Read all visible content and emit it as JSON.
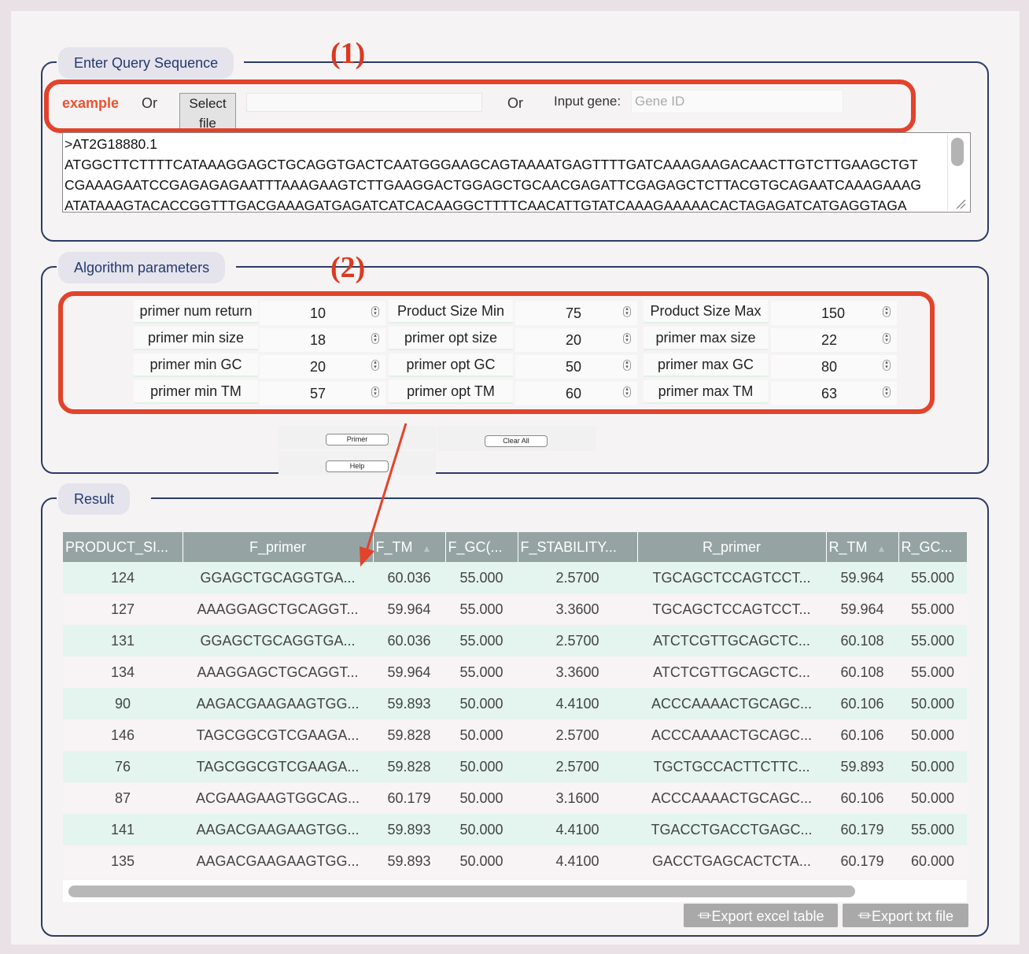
{
  "annotations": {
    "label1": "(1)",
    "label2": "(2)"
  },
  "query": {
    "legend": "Enter Query Sequence",
    "example_link": "example",
    "or_text": "Or",
    "select_file_label": "Select file",
    "input_gene_label": "Input gene:",
    "gene_placeholder": "Gene ID",
    "sequence_lines": [
      ">AT2G18880.1",
      "ATGGCTTCTTTTCATAAAGGAGCTGCAGGTGACTCAATGGGAAGCAGTAAAATGAGTTTTGATCAAAGAAGACAACTTGTCTTGAAGCTGT",
      "CGAAAGAATCCGAGAGAGAATTTAAAGAAGTCTTGAAGGACTGGAGCTGCAACGAGATTCGAGAGCTCTTACGTGCAGAATCAAAGAAAG",
      "ATATAAAGTACACCGGTTTGACGAAAGATGAGATCATCACAAGGCTTTTCAACATTGTATCAAAGAAAAACACTAGAGATCATGAGGTAGA"
    ]
  },
  "params": {
    "legend": "Algorithm parameters",
    "rows": [
      [
        {
          "label": "primer num return",
          "value": "10"
        },
        {
          "label": "Product Size Min",
          "value": "75"
        },
        {
          "label": "Product Size Max",
          "value": "150"
        }
      ],
      [
        {
          "label": "primer min size",
          "value": "18"
        },
        {
          "label": "primer opt size",
          "value": "20"
        },
        {
          "label": "primer max size",
          "value": "22"
        }
      ],
      [
        {
          "label": "primer min GC",
          "value": "20"
        },
        {
          "label": "primer opt GC",
          "value": "50"
        },
        {
          "label": "primer max GC",
          "value": "80"
        }
      ],
      [
        {
          "label": "primer min TM",
          "value": "57"
        },
        {
          "label": "primer opt TM",
          "value": "60"
        },
        {
          "label": "primer max TM",
          "value": "63"
        }
      ]
    ],
    "buttons": {
      "primer": "Primer",
      "clear_all": "Clear All",
      "help": "Help"
    }
  },
  "result": {
    "legend": "Result",
    "columns": [
      "PRODUCT_SI...",
      "F_primer",
      "F_TM",
      "F_GC(...",
      "F_STABILITY...",
      "R_primer",
      "R_TM",
      "R_GC..."
    ],
    "rows": [
      [
        "124",
        "GGAGCTGCAGGTGA...",
        "60.036",
        "55.000",
        "2.5700",
        "TGCAGCTCCAGTCCT...",
        "59.964",
        "55.000"
      ],
      [
        "127",
        "AAAGGAGCTGCAGGT...",
        "59.964",
        "55.000",
        "3.3600",
        "TGCAGCTCCAGTCCT...",
        "59.964",
        "55.000"
      ],
      [
        "131",
        "GGAGCTGCAGGTGA...",
        "60.036",
        "55.000",
        "2.5700",
        "ATCTCGTTGCAGCTC...",
        "60.108",
        "55.000"
      ],
      [
        "134",
        "AAAGGAGCTGCAGGT...",
        "59.964",
        "55.000",
        "3.3600",
        "ATCTCGTTGCAGCTC...",
        "60.108",
        "55.000"
      ],
      [
        "90",
        "AAGACGAAGAAGTGG...",
        "59.893",
        "50.000",
        "4.4100",
        "ACCCAAAACTGCAGC...",
        "60.106",
        "50.000"
      ],
      [
        "146",
        "TAGCGGCGTCGAAGA...",
        "59.828",
        "50.000",
        "2.5700",
        "ACCCAAAACTGCAGC...",
        "60.106",
        "50.000"
      ],
      [
        "76",
        "TAGCGGCGTCGAAGA...",
        "59.828",
        "50.000",
        "2.5700",
        "TGCTGCCACTTCTTC...",
        "59.893",
        "50.000"
      ],
      [
        "87",
        "ACGAAGAAGTGGCAG...",
        "60.179",
        "50.000",
        "3.1600",
        "ACCCAAAACTGCAGC...",
        "60.106",
        "50.000"
      ],
      [
        "141",
        "AAGACGAAGAAGTGG...",
        "59.893",
        "50.000",
        "4.4100",
        "TGACCTGACCTGAGC...",
        "60.179",
        "55.000"
      ],
      [
        "135",
        "AAGACGAAGAAGTGG...",
        "59.893",
        "50.000",
        "4.4100",
        "GACCTGAGCACTCTA...",
        "60.179",
        "60.000"
      ]
    ],
    "export_excel": "Export excel table",
    "export_txt": "Export txt file"
  },
  "colors": {
    "accent_red": "#e2432b",
    "panel_border": "#2b3b66",
    "header_bg": "#95a4a3",
    "row_even": "#e4f4ef"
  },
  "icons": {
    "export": "download-icon",
    "sort": "sort-icon"
  }
}
